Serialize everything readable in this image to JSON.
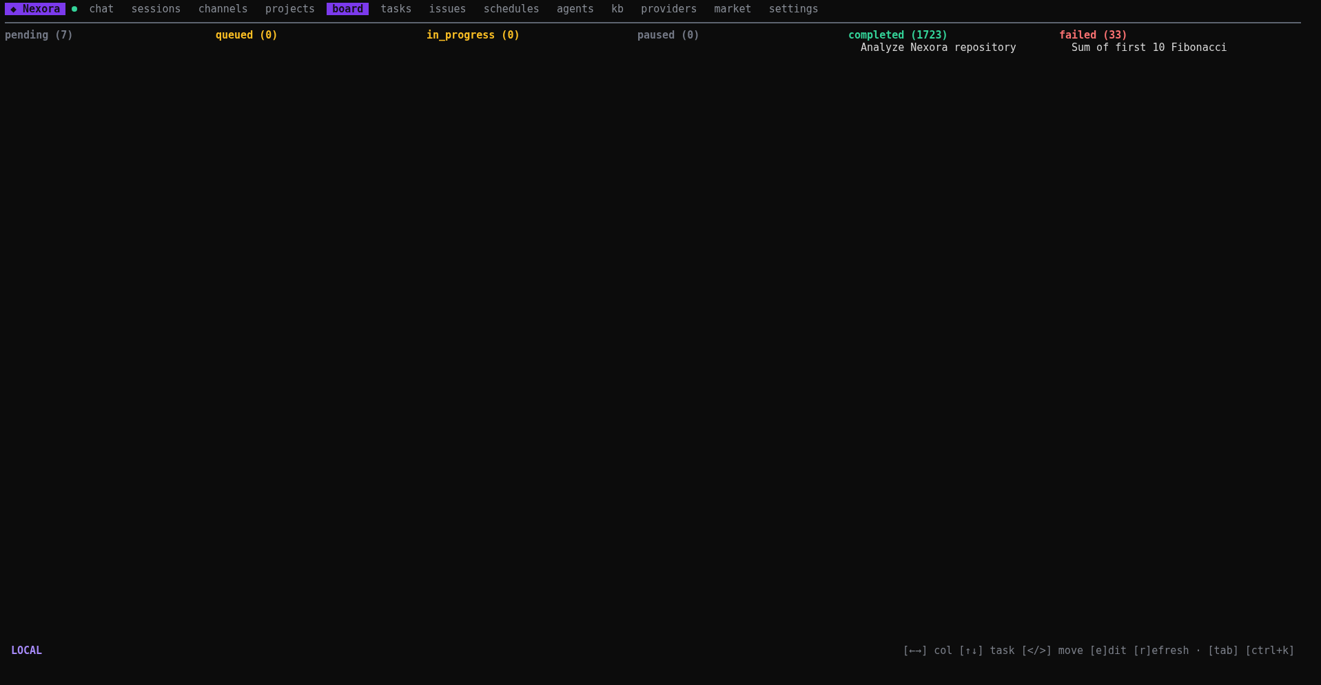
{
  "brand": "◆ Nexora",
  "connected": true,
  "tabs": [
    {
      "label": "chat",
      "selected": false
    },
    {
      "label": "sessions",
      "selected": false
    },
    {
      "label": "channels",
      "selected": false
    },
    {
      "label": "projects",
      "selected": false
    },
    {
      "label": "board",
      "selected": true
    },
    {
      "label": "tasks",
      "selected": false
    },
    {
      "label": "issues",
      "selected": false
    },
    {
      "label": "schedules",
      "selected": false
    },
    {
      "label": "agents",
      "selected": false
    },
    {
      "label": "kb",
      "selected": false
    },
    {
      "label": "providers",
      "selected": false
    },
    {
      "label": "market",
      "selected": false
    },
    {
      "label": "settings",
      "selected": false
    }
  ],
  "columns": [
    {
      "title": "pending (7)",
      "color": "#737885"
    },
    {
      "title": "queued (0)",
      "color": "#fbbf24"
    },
    {
      "title": "in_progress (0)",
      "color": "#fbbf24"
    },
    {
      "title": "paused (0)",
      "color": "#737885"
    },
    {
      "title": "completed (1723)",
      "color": "#34d399",
      "tasks": [
        "Analyze Nexora repository"
      ]
    },
    {
      "title": "failed (33)",
      "color": "#f87171",
      "tasks": [
        "Sum of first 10 Fibonacci"
      ]
    }
  ],
  "status_bar": {
    "mode": "LOCAL",
    "hints": "[←→] col [↑↓] task [</>] move [e]dit [r]efresh · [tab] [ctrl+k]"
  }
}
